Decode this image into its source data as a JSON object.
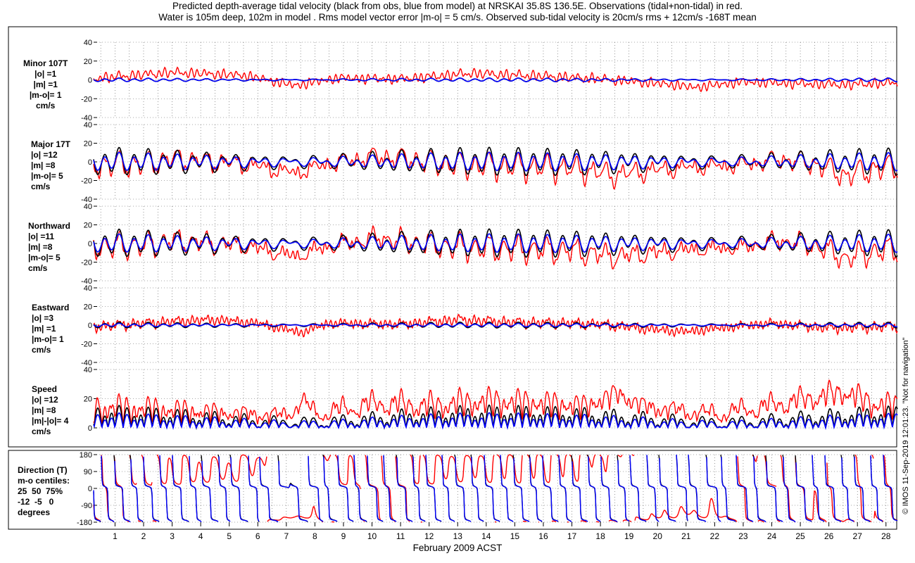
{
  "title_line1": "Predicted depth-average tidal velocity (black from obs, blue from model) at NRSKAI 35.8S 136.5E. Observations (tidal+non-tidal) in red.",
  "title_line2": "Water is 105m deep, 102m in model . Rms model vector error |m-o| = 5 cm/s. Observed sub-tidal velocity is 20cm/s rms + 12cm/s -168T mean",
  "credit": "© IMOS 11-Sep-2019 12:01:23. \"Not for navigation\"",
  "chart_data": {
    "type": "line",
    "xlabel": "February 2009 ACST",
    "x_ticks": [
      "1",
      "2",
      "3",
      "4",
      "5",
      "6",
      "7",
      "8",
      "9",
      "10",
      "11",
      "12",
      "13",
      "14",
      "15",
      "16",
      "17",
      "18",
      "19",
      "20",
      "21",
      "22",
      "23",
      "24",
      "25",
      "26",
      "27",
      "28"
    ],
    "x_range_days": [
      0.25,
      28.4
    ],
    "series_legend": {
      "obs_tidal": "#000000",
      "model": "#0000ff",
      "observed": "#ff0000"
    },
    "panels": [
      {
        "key": "minor",
        "label_lines": [
          "Minor 107T",
          "|o| =1",
          "|m| =1",
          "|m-o|= 1",
          "cm/s"
        ],
        "y_ticks": [
          "40",
          "20",
          "0",
          "-20",
          "-40"
        ],
        "ylim": [
          -40,
          40
        ],
        "black": {
          "amp": 1.5,
          "offset": 0
        },
        "blue": {
          "amp": 1.5,
          "offset": 0
        },
        "red": {
          "amp": 2,
          "noise": 3,
          "trend": [
            [
              0,
              1
            ],
            [
              3,
              8
            ],
            [
              5.5,
              5
            ],
            [
              7.3,
              -6
            ],
            [
              8.8,
              2
            ],
            [
              11,
              1
            ],
            [
              13.5,
              7
            ],
            [
              16,
              4
            ],
            [
              18,
              1
            ],
            [
              20.5,
              -5
            ],
            [
              21.3,
              -8
            ],
            [
              23,
              -2
            ],
            [
              25,
              -4
            ],
            [
              26.5,
              -5
            ],
            [
              28.4,
              -3
            ]
          ]
        }
      },
      {
        "key": "major",
        "label_lines": [
          "Major 17T",
          "|o| =12",
          "|m| =8",
          "|m-o|= 5",
          "cm/s"
        ],
        "y_ticks": [
          "40",
          "20",
          "0",
          "-20",
          "-40"
        ],
        "ylim": [
          -40,
          40
        ],
        "black": {
          "amp": 12,
          "offset": 0
        },
        "blue": {
          "amp": 8,
          "offset": 0
        },
        "red": {
          "amp": 12,
          "noise": 3,
          "trend": [
            [
              0,
              -3
            ],
            [
              2,
              -2
            ],
            [
              3,
              3
            ],
            [
              5.5,
              -2
            ],
            [
              7.3,
              -12
            ],
            [
              8.5,
              -2
            ],
            [
              10.2,
              6
            ],
            [
              11.5,
              2
            ],
            [
              13,
              -3
            ],
            [
              15,
              -5
            ],
            [
              17,
              -7
            ],
            [
              18.5,
              -14
            ],
            [
              19.5,
              -10
            ],
            [
              21,
              -6
            ],
            [
              23,
              -3
            ],
            [
              24.3,
              3
            ],
            [
              25.5,
              -2
            ],
            [
              26.6,
              -15
            ],
            [
              27.5,
              -8
            ],
            [
              28.4,
              -5
            ]
          ]
        }
      },
      {
        "key": "north",
        "label_lines": [
          "Northward",
          "|o| =11",
          "|m| =8",
          "|m-o|= 5",
          "cm/s"
        ],
        "y_ticks": [
          "40",
          "20",
          "0",
          "-20",
          "-40"
        ],
        "ylim": [
          -40,
          40
        ],
        "black": {
          "amp": 12,
          "offset": 0
        },
        "blue": {
          "amp": 8,
          "offset": 0
        },
        "red": {
          "amp": 12,
          "noise": 3,
          "trend": [
            [
              0,
              -3
            ],
            [
              2,
              -2
            ],
            [
              3,
              3
            ],
            [
              5.5,
              -2
            ],
            [
              7.3,
              -14
            ],
            [
              8.5,
              -3
            ],
            [
              10.2,
              6
            ],
            [
              11.5,
              1
            ],
            [
              13,
              -4
            ],
            [
              15,
              -6
            ],
            [
              17,
              -8
            ],
            [
              18.5,
              -14
            ],
            [
              19.5,
              -11
            ],
            [
              21,
              -7
            ],
            [
              23,
              -4
            ],
            [
              24.3,
              3
            ],
            [
              25.5,
              -2
            ],
            [
              26.6,
              -16
            ],
            [
              27.5,
              -9
            ],
            [
              28.4,
              -6
            ]
          ]
        }
      },
      {
        "key": "east",
        "label_lines": [
          "Eastward",
          "|o| =3",
          "|m| =1",
          "|m-o|= 1",
          "cm/s"
        ],
        "y_ticks": [
          "40",
          "20",
          "0",
          "-20",
          "-40"
        ],
        "ylim": [
          -40,
          40
        ],
        "black": {
          "amp": 2.5,
          "offset": 0
        },
        "blue": {
          "amp": 1.5,
          "offset": 0
        },
        "red": {
          "amp": 3,
          "noise": 3,
          "trend": [
            [
              0,
              -2
            ],
            [
              3,
              4
            ],
            [
              4.5,
              6
            ],
            [
              6,
              2
            ],
            [
              7.5,
              -8
            ],
            [
              8.5,
              2
            ],
            [
              11,
              1
            ],
            [
              13,
              6
            ],
            [
              15,
              3
            ],
            [
              17,
              2
            ],
            [
              18,
              1
            ],
            [
              20,
              -5
            ],
            [
              21,
              -7
            ],
            [
              22.5,
              -2
            ],
            [
              24,
              2
            ],
            [
              26,
              -3
            ],
            [
              27.5,
              -2
            ],
            [
              28.4,
              -1
            ]
          ]
        }
      },
      {
        "key": "speed",
        "label_lines": [
          "Speed",
          "|o| =12",
          "|m| =8",
          "|m|-|o|= 4",
          "cm/s"
        ],
        "y_ticks": [
          "40",
          "20",
          "0"
        ],
        "ylim": [
          0,
          40
        ],
        "black": {
          "amp": 12,
          "offset": 0
        },
        "blue": {
          "amp": 8,
          "offset": 0
        },
        "red": {
          "amp": 14,
          "noise": 4,
          "trend": [
            [
              0,
              1
            ],
            [
              7,
              2
            ],
            [
              7.6,
              12
            ],
            [
              8,
              3
            ],
            [
              10.2,
              8
            ],
            [
              12,
              4
            ],
            [
              14,
              6
            ],
            [
              17.5,
              4
            ],
            [
              18.6,
              14
            ],
            [
              19.5,
              6
            ],
            [
              22,
              3
            ],
            [
              26.6,
              14
            ],
            [
              27.5,
              5
            ],
            [
              28.4,
              3
            ]
          ]
        }
      },
      {
        "key": "direction",
        "label_lines": [
          "Direction (T)",
          "m-o centiles:",
          "25  50  75%",
          "-12  -5   0",
          "degrees"
        ],
        "y_ticks": [
          "180",
          "90",
          "0",
          "-90",
          "-180"
        ],
        "ylim": [
          -180,
          180
        ]
      }
    ]
  }
}
